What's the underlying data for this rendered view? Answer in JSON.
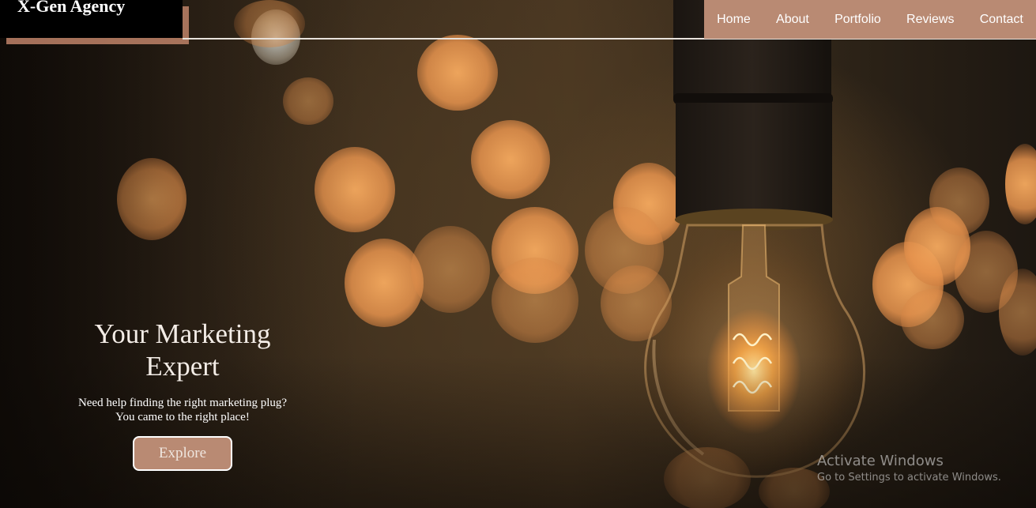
{
  "brand": {
    "name": "X-Gen Agency"
  },
  "nav": {
    "items": [
      {
        "label": "Home"
      },
      {
        "label": "About"
      },
      {
        "label": "Portfolio"
      },
      {
        "label": "Reviews"
      },
      {
        "label": "Contact"
      }
    ]
  },
  "hero": {
    "title_line1": "Your Marketing",
    "title_line2": "Expert",
    "subtitle_line1": "Need help finding the right marketing plug?",
    "subtitle_line2": "You came to the right place!",
    "cta_label": "Explore"
  },
  "watermark": {
    "title": "Activate Windows",
    "subtitle": "Go to Settings to activate Windows."
  },
  "colors": {
    "accent": "#b98a73",
    "header_bg": "#000000",
    "text": "#ffffff"
  }
}
